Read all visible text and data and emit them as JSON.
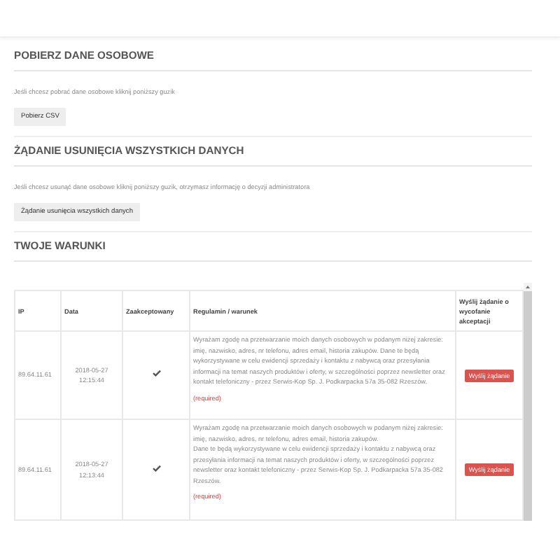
{
  "sections": [
    {
      "heading": "POBIERZ DANE OSOBOWE",
      "text": "Jeśli chcesz pobrać dane osobowe kliknij poniższy guzik",
      "button": "Pobierz CSV"
    },
    {
      "heading": "ŻĄDANIE USUNIĘCIA WSZYSTKICH DANYCH",
      "text": "Jeśli chcesz usunąć dane osobowe kliknij poniższy guzik, otrzymasz informację o decyzji administratora",
      "button": "Żądanie usunięcia wszystkich danych"
    },
    {
      "heading": "TWOJE WARUNKI"
    }
  ],
  "table": {
    "columns": [
      "IP",
      "Data",
      "Zaakceptowany",
      "Regulamin / warunek",
      "Wyślij żądanie o wycofanie akceptacji"
    ],
    "rows": [
      {
        "ip": "89.64.11.61",
        "date": "2018-05-27 12:15:44",
        "accepted": true,
        "paragraphs": [
          "Wyrażam zgodę na przetwarzanie moich danych osobowych w podanym niżej zakresie: imię, nazwisko, adres, nr telefonu, adres email, historia zakupów. Dane te będą wykorzystywane w celu ewidencji sprzedaży i kontaktu z nabywcą oraz przesyłania informacji na temat naszych produktów i oferty, w szczególności poprzez newsletter oraz kontakt telefoniczny - przez Serwis-Kop Sp. J. Podkarpacka 57a 35-082 Rzeszów."
        ],
        "required": "(required)",
        "action": "Wyślij żądanie"
      },
      {
        "ip": "89.64.11.61",
        "date": "2018-05-27 12:13:44",
        "accepted": true,
        "paragraphs": [
          "Wyrażam zgodę na przetwarzanie moich danych osobowych w podanym niżej zakresie: imię, nazwisko, adres, nr telefonu, adres email, historia zakupów.",
          "Dane te będą wykorzystywane w celu ewidencji sprzedaży i kontaktu z nabywcą oraz przesyłania informacji na temat naszych produktów i oferty, w szczególności poprzez newsletter oraz kontakt telefoniczny - przez Serwis-Kop Sp. J. Podkarpacka 57a 35-082 Rzeszów."
        ],
        "required": "(required)",
        "action": "Wyślij żądanie"
      }
    ]
  }
}
